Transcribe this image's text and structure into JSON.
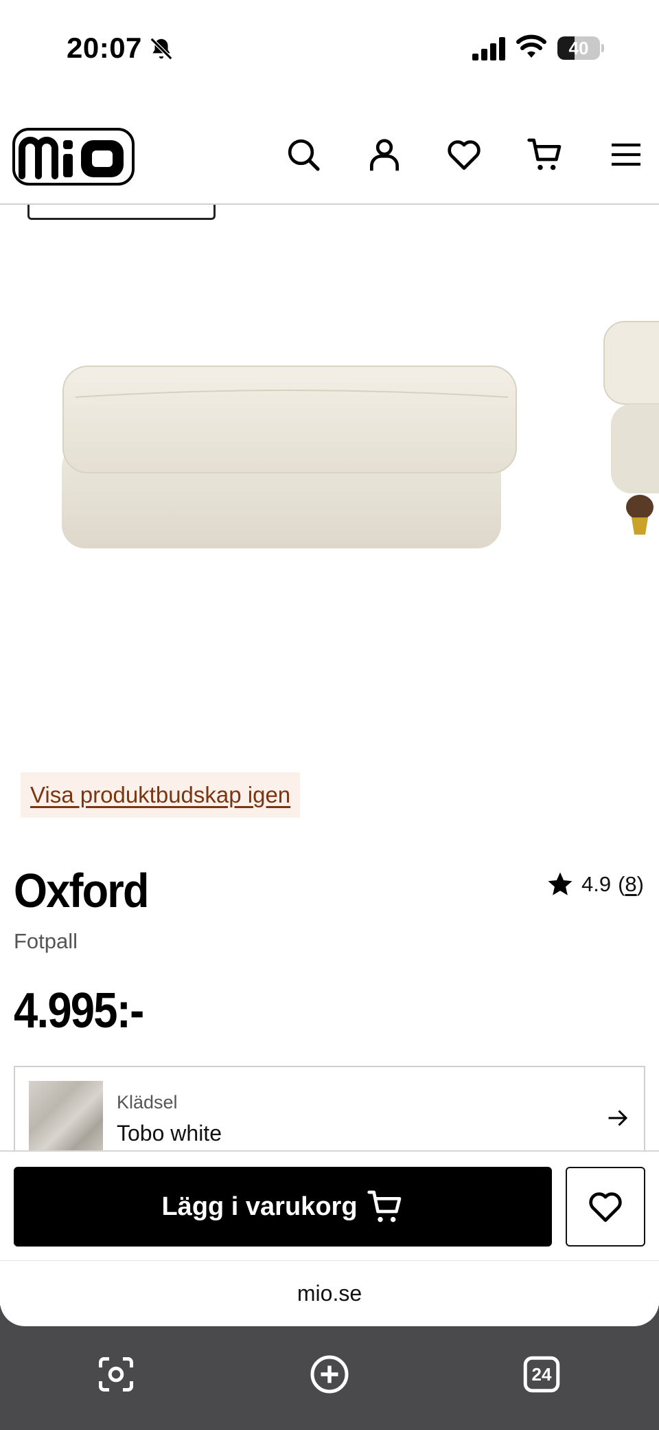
{
  "status_bar": {
    "time": "20:07",
    "battery_level": "40",
    "battery_fraction": 0.4
  },
  "header": {
    "logo_text": "mio",
    "icons": [
      "search-icon",
      "account-icon",
      "heart-icon",
      "cart-icon",
      "menu-icon"
    ]
  },
  "gallery": {
    "promo_link": "Visa produktbudskap igen"
  },
  "product": {
    "title": "Oxford",
    "subtitle": "Fotpall",
    "price": "4.995:-",
    "rating": "4.9",
    "review_count": "8",
    "review_open": "(",
    "review_close": ")"
  },
  "fabric": {
    "label": "Klädsel",
    "value": "Tobo white"
  },
  "actions": {
    "add_to_cart_label": "Lägg i varukorg"
  },
  "browser": {
    "url": "mio.se",
    "tab_count": "24"
  },
  "colors": {
    "brand": "#000000",
    "promo_bg": "#fbf1ea",
    "promo_text": "#7a3513",
    "toolbar_bg": "#4a4a4c"
  }
}
